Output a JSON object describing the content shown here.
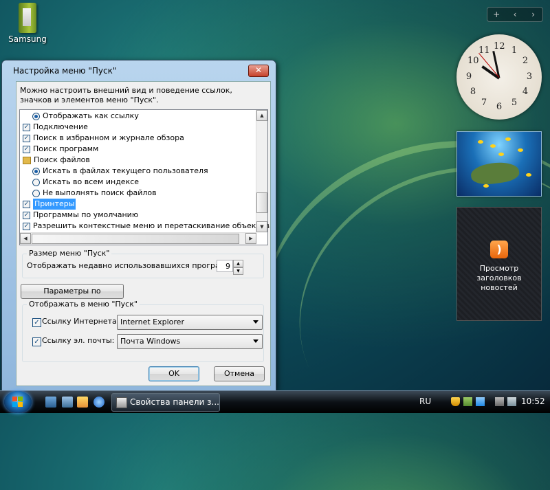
{
  "desktop": {
    "icon_label": "Samsung"
  },
  "sidebar": {
    "controls": [
      "+",
      "‹",
      "›"
    ],
    "clock_numbers": [
      "12",
      "1",
      "2",
      "3",
      "4",
      "5",
      "6",
      "7",
      "8",
      "9",
      "10",
      "11"
    ],
    "clock_time": "10:52",
    "feed_title": "Просмотр заголовков новостей"
  },
  "dialog": {
    "title": "Настройка меню \"Пуск\"",
    "close_icon": "close-icon",
    "description": "Можно настроить внешний вид и поведение ссылок, значков и элементов меню \"Пуск\".",
    "tree_items": [
      {
        "type": "radio",
        "checked": true,
        "label": "Отображать как ссылку",
        "level": 1
      },
      {
        "type": "checkbox",
        "checked": true,
        "label": "Подключение",
        "level": 0
      },
      {
        "type": "checkbox",
        "checked": true,
        "label": "Поиск в избранном и журнале обзора",
        "level": 0
      },
      {
        "type": "checkbox",
        "checked": true,
        "label": "Поиск программ",
        "level": 0
      },
      {
        "type": "folder",
        "checked": false,
        "label": "Поиск файлов",
        "level": 0
      },
      {
        "type": "radio",
        "checked": true,
        "label": "Искать в файлах текущего пользователя",
        "level": 1
      },
      {
        "type": "radio",
        "checked": false,
        "label": "Искать во всем индексе",
        "level": 1
      },
      {
        "type": "radio",
        "checked": false,
        "label": "Не выполнять поиск файлов",
        "level": 1
      },
      {
        "type": "checkbox",
        "checked": true,
        "label": "Принтеры",
        "level": 0,
        "selected": true
      },
      {
        "type": "checkbox",
        "checked": true,
        "label": "Программы по умолчанию",
        "level": 0
      },
      {
        "type": "checkbox",
        "checked": true,
        "label": "Разрешить контекстные меню и перетаскивание объектов",
        "level": 0
      }
    ],
    "size_group": {
      "title": "Размер меню \"Пуск\"",
      "recent_label": "Отображать недавно использовавшихся программ:",
      "recent_value": "9"
    },
    "defaults_button": "Параметры по умолчанию",
    "show_group": {
      "title": "Отображать в меню \"Пуск\"",
      "internet_label": "Ссылку Интернета:",
      "internet_value": "Internet Explorer",
      "email_label": "Ссылку эл. почты:",
      "email_value": "Почта Windows"
    },
    "ok_button": "OK",
    "cancel_button": "Отмена"
  },
  "taskbar": {
    "task_title": "Свойства панели з...",
    "language": "RU",
    "time": "10:52"
  },
  "colors": {
    "selection": "#3399ff",
    "close_button": "#c7412b",
    "rss": "#e8650b"
  }
}
